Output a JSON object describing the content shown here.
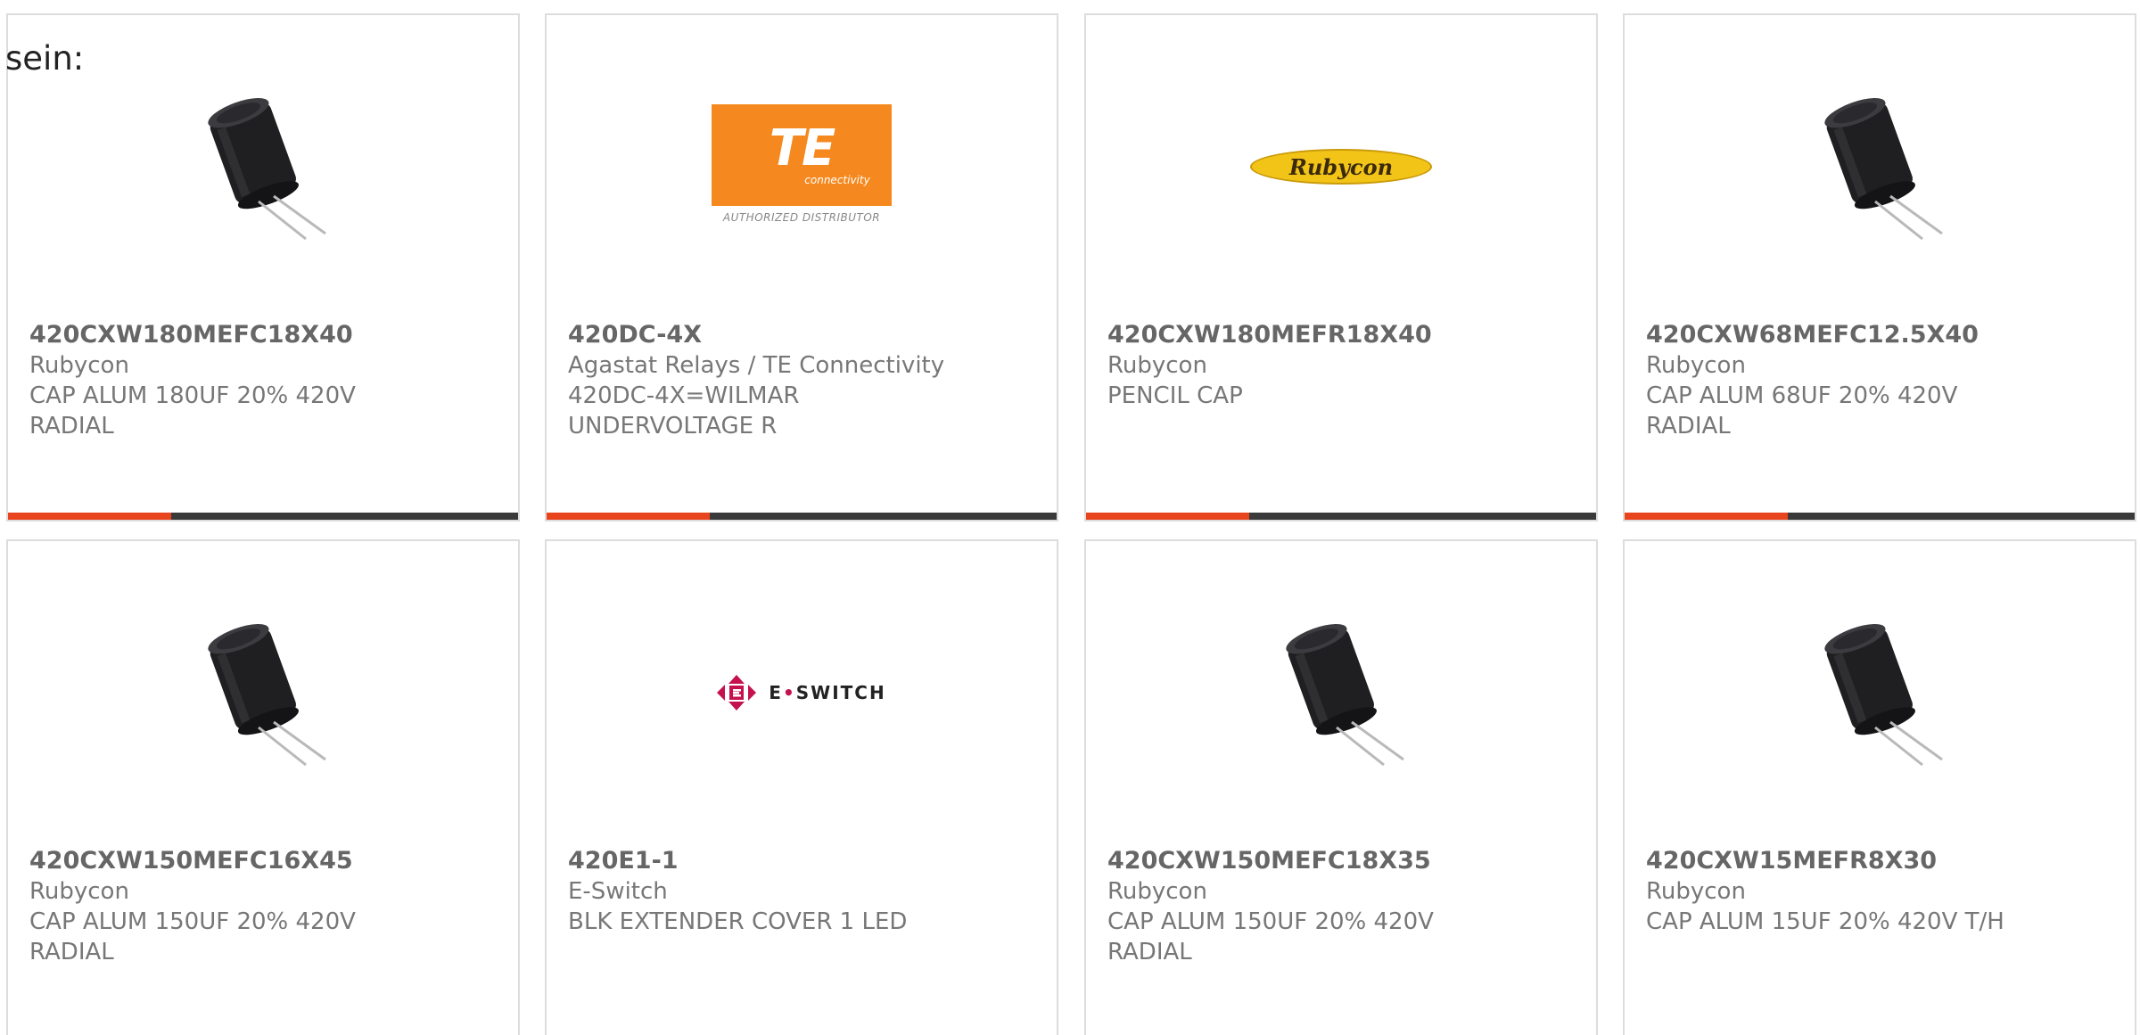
{
  "intro_text": "sein:",
  "brand_colors": {
    "accent": "#e8441d",
    "bar": "#3a3a3a",
    "te_orange": "#f5891f",
    "rubycon_yellow": "#f2c418",
    "eswitch_magenta": "#c4124f"
  },
  "products": [
    {
      "part_number": "420CXW180MEFC18X40",
      "manufacturer": "Rubycon",
      "description_line1": "CAP ALUM 180UF 20% 420V",
      "description_line2": "RADIAL",
      "image": "capacitor-image"
    },
    {
      "part_number": "420DC-4X",
      "manufacturer": "Agastat Relays / TE Connectivity",
      "description_line1": "420DC-4X=WILMAR",
      "description_line2": "UNDERVOLTAGE R",
      "image": "te-connectivity-logo",
      "logo": {
        "main": "TE",
        "sub": "connectivity",
        "tagline": "AUTHORIZED DISTRIBUTOR"
      }
    },
    {
      "part_number": "420CXW180MEFR18X40",
      "manufacturer": "Rubycon",
      "description_line1": "PENCIL CAP",
      "description_line2": "",
      "image": "rubycon-logo",
      "logo": {
        "text": "Rubycon"
      }
    },
    {
      "part_number": "420CXW68MEFC12.5X40",
      "manufacturer": "Rubycon",
      "description_line1": "CAP ALUM 68UF 20% 420V",
      "description_line2": "RADIAL",
      "image": "capacitor-image"
    },
    {
      "part_number": "420CXW150MEFC16X45",
      "manufacturer": "Rubycon",
      "description_line1": "CAP ALUM 150UF 20% 420V",
      "description_line2": "RADIAL",
      "image": "capacitor-image"
    },
    {
      "part_number": "420E1-1",
      "manufacturer": "E-Switch",
      "description_line1": "BLK EXTENDER COVER 1 LED",
      "description_line2": "",
      "image": "e-switch-logo",
      "logo": {
        "text_left": "E",
        "text_right": "SWITCH"
      }
    },
    {
      "part_number": "420CXW150MEFC18X35",
      "manufacturer": "Rubycon",
      "description_line1": "CAP ALUM 150UF 20% 420V",
      "description_line2": "RADIAL",
      "image": "capacitor-image"
    },
    {
      "part_number": "420CXW15MEFR8X30",
      "manufacturer": "Rubycon",
      "description_line1": "CAP ALUM 15UF 20% 420V T/H",
      "description_line2": "",
      "image": "capacitor-image"
    }
  ]
}
